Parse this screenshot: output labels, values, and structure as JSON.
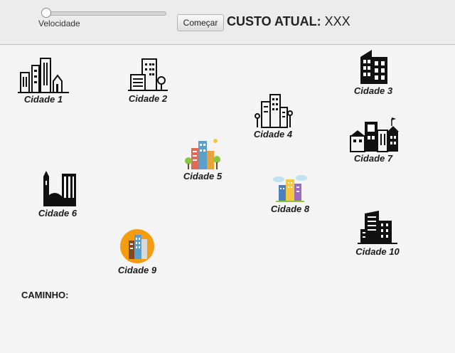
{
  "controls": {
    "speed_label": "Velocidade",
    "speed_value": 0,
    "start_button": "Começar",
    "cost_label": "CUSTO ATUAL:",
    "cost_value": "XXX"
  },
  "cities": [
    {
      "label": "Cidade 1",
      "icon": "city-skyline-icon"
    },
    {
      "label": "Cidade 2",
      "icon": "office-building-icon"
    },
    {
      "label": "Cidade 3",
      "icon": "building-icon"
    },
    {
      "label": "Cidade 4",
      "icon": "city-buildings-icon"
    },
    {
      "label": "Cidade 5",
      "icon": "colorful-city-icon"
    },
    {
      "label": "Cidade 6",
      "icon": "church-town-icon"
    },
    {
      "label": "Cidade 7",
      "icon": "town-houses-icon"
    },
    {
      "label": "Cidade 8",
      "icon": "city-clouds-icon"
    },
    {
      "label": "Cidade 9",
      "icon": "city-badge-icon"
    },
    {
      "label": "Cidade 10",
      "icon": "tower-icon"
    }
  ],
  "path": {
    "label": "CAMINHO:"
  }
}
